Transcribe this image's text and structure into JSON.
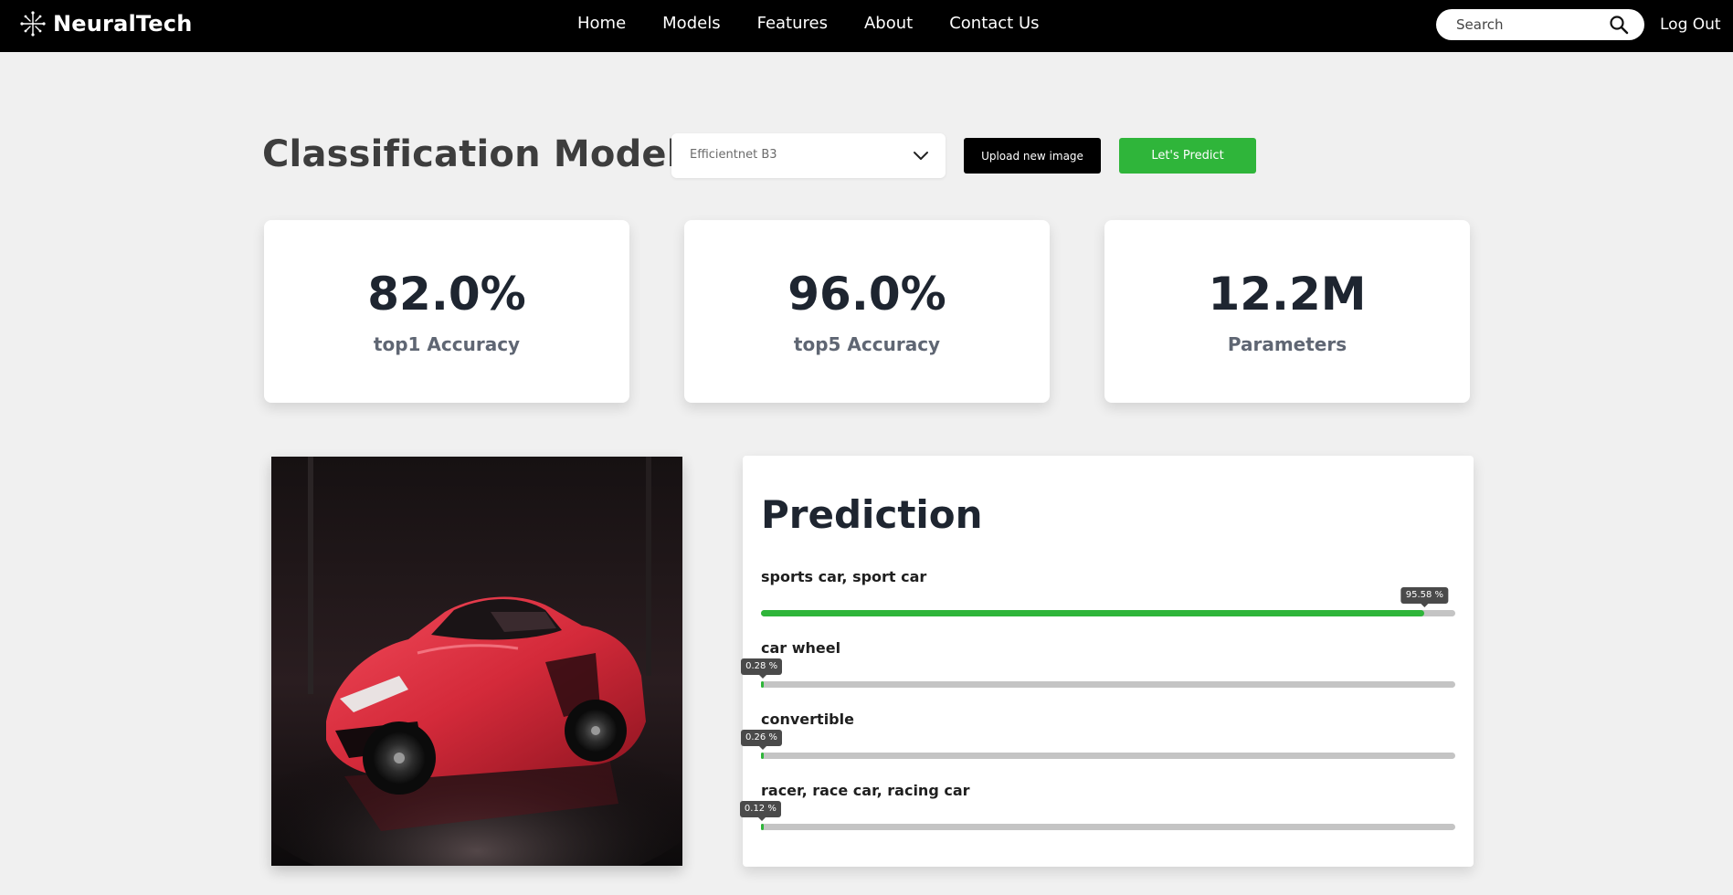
{
  "nav": {
    "brand": "NeuralTech",
    "links": [
      "Home",
      "Models",
      "Features",
      "About",
      "Contact Us"
    ],
    "search_placeholder": "Search",
    "logout_label": "Log Out"
  },
  "header": {
    "title": "Classification Model",
    "model_select": {
      "selected": "Efficientnet B3"
    },
    "upload_label": "Upload new image",
    "predict_label": "Let's Predict"
  },
  "stats": [
    {
      "value": "82.0%",
      "label": "top1 Accuracy"
    },
    {
      "value": "96.0%",
      "label": "top5 Accuracy"
    },
    {
      "value": "12.2M",
      "label": "Parameters"
    }
  ],
  "prediction": {
    "title": "Prediction",
    "items": [
      {
        "label": "sports car, sport car",
        "value_text": "95.58 %",
        "fraction": 0.9558
      },
      {
        "label": "car wheel",
        "value_text": "0.28 %",
        "fraction": 0.0028
      },
      {
        "label": "convertible",
        "value_text": "0.26 %",
        "fraction": 0.0026
      },
      {
        "label": "racer, race car, racing car",
        "value_text": "0.12 %",
        "fraction": 0.0012
      }
    ]
  },
  "colors": {
    "navbar": "#000000",
    "accent_green": "#2fb53a",
    "page_background": "#f0f0f0",
    "car_red": "#d42a3a"
  },
  "icons": {
    "logo": "circuit-logo-icon",
    "search": "search-icon",
    "select": "chevron-down-icon"
  }
}
